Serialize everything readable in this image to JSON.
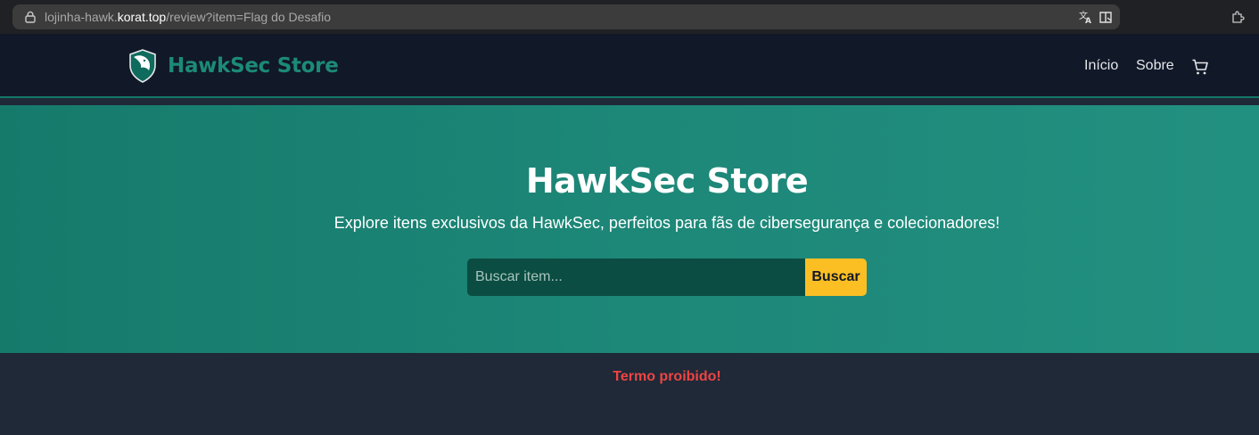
{
  "browser": {
    "url_prefix": "lojinha-hawk.",
    "url_host": "korat.top",
    "url_path": "/review?item=Flag do Desafio"
  },
  "header": {
    "brand": "HawkSec Store",
    "nav": [
      "Início",
      "Sobre"
    ]
  },
  "hero": {
    "title": "HawkSec Store",
    "subtitle": "Explore itens exclusivos da HawkSec, perfeitos para fãs de cibersegurança e colecionadores!",
    "search_placeholder": "Buscar item...",
    "search_button": "Buscar"
  },
  "message": {
    "text": "Termo proibido!"
  },
  "colors": {
    "header_bg": "#111827",
    "brand": "#1c8a78",
    "hero_bg": "#1d8778",
    "button": "#fbbf24",
    "error": "#ef4444"
  },
  "icons": [
    "lock-icon",
    "translate-icon",
    "reader-mode-icon",
    "extensions-icon",
    "hawk-shield-logo-icon",
    "cart-icon"
  ]
}
